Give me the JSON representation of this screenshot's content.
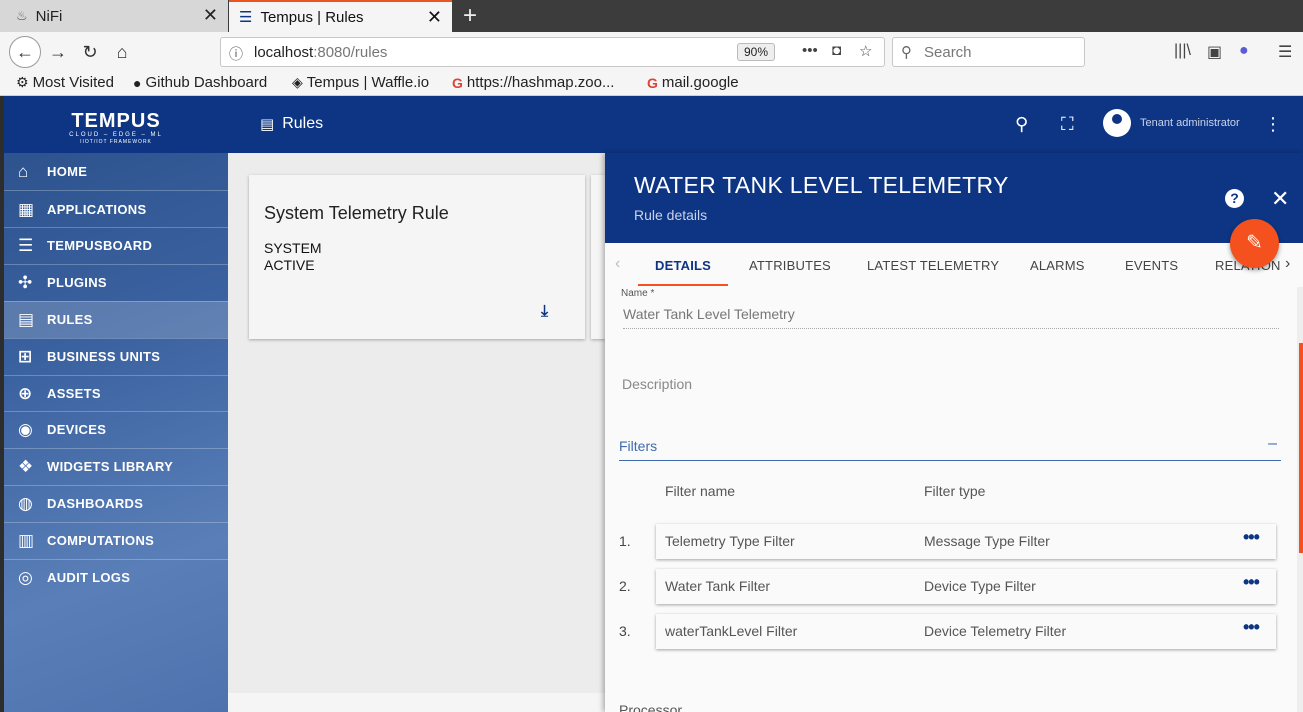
{
  "browser": {
    "tabs": [
      {
        "title": "NiFi"
      },
      {
        "title": "Tempus | Rules"
      }
    ],
    "url": {
      "host": "localhost",
      "rest": ":8080/rules"
    },
    "zoom": "90%",
    "search_placeholder": "Search",
    "bookmarks": [
      {
        "label": "Most Visited"
      },
      {
        "label": "Github Dashboard"
      },
      {
        "label": "Tempus | Waffle.io"
      },
      {
        "label": "https://hashmap.zoo..."
      },
      {
        "label": "mail.google"
      }
    ]
  },
  "app": {
    "logo": "TEMPUS",
    "logo_sub": "CLOUD – EDGE – ML",
    "logo_sub2": "IIOT/IOT FRAMEWORK",
    "page_title": "Rules",
    "user": "Tenant administrator",
    "sidebar": [
      {
        "label": "HOME",
        "icon": "home-icon"
      },
      {
        "label": "APPLICATIONS",
        "icon": "apps-icon"
      },
      {
        "label": "TEMPUSBOARD",
        "icon": "board-icon"
      },
      {
        "label": "PLUGINS",
        "icon": "plugin-icon"
      },
      {
        "label": "RULES",
        "icon": "rules-icon"
      },
      {
        "label": "BUSINESS UNITS",
        "icon": "business-units-icon"
      },
      {
        "label": "ASSETS",
        "icon": "assets-icon"
      },
      {
        "label": "DEVICES",
        "icon": "devices-icon"
      },
      {
        "label": "WIDGETS LIBRARY",
        "icon": "widgets-icon"
      },
      {
        "label": "DASHBOARDS",
        "icon": "dashboards-icon"
      },
      {
        "label": "COMPUTATIONS",
        "icon": "computations-icon"
      },
      {
        "label": "AUDIT LOGS",
        "icon": "audit-icon"
      }
    ],
    "active_item": "RULES"
  },
  "card": {
    "title": "System Telemetry Rule",
    "line1": "SYSTEM",
    "line2": "ACTIVE"
  },
  "panel": {
    "title": "WATER TANK LEVEL TELEMETRY",
    "subtitle": "Rule details",
    "tabs": [
      "DETAILS",
      "ATTRIBUTES",
      "LATEST TELEMETRY",
      "ALARMS",
      "EVENTS",
      "RELATION"
    ],
    "active_tab": "DETAILS",
    "name_label": "Name *",
    "name_value": "Water Tank Level Telemetry",
    "description_label": "Description",
    "filters_label": "Filters",
    "filter_name_header": "Filter name",
    "filter_type_header": "Filter type",
    "filters": [
      {
        "num": "1.",
        "name": "Telemetry Type Filter",
        "type": "Message Type Filter"
      },
      {
        "num": "2.",
        "name": "Water Tank Filter",
        "type": "Device Type Filter"
      },
      {
        "num": "3.",
        "name": "waterTankLevel Filter",
        "type": "Device Telemetry Filter"
      }
    ],
    "processor_label": "Processor"
  },
  "colors": {
    "primary": "#0e3584",
    "accent": "#f4511e",
    "browser_tab_accent": "#e95420"
  }
}
